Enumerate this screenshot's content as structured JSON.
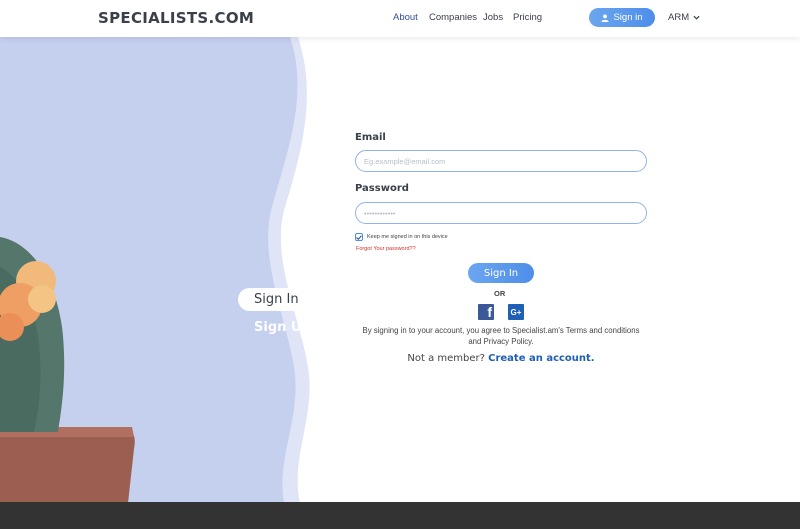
{
  "header": {
    "logo": "SPECIALISTS.COM",
    "nav": [
      "About",
      "Companies",
      "Jobs",
      "Pricing"
    ],
    "active_nav": "About",
    "signin_button": "Sign in",
    "language": "ARM"
  },
  "side_tabs": {
    "signin": "Sign In",
    "signup": "Sign Up"
  },
  "form": {
    "email_label": "Email",
    "email_placeholder": "Eg.example@email.com",
    "password_label": "Password",
    "password_placeholder": "••••••••••••",
    "keep_signed_in": "Keep me signed in on this device",
    "keep_signed_in_checked": true,
    "forgot_password": "Forgot Your password??",
    "submit": "Sign In",
    "or": "OR",
    "social": [
      "facebook-icon",
      "google-plus-icon"
    ],
    "terms": "By signing in to your account, you agree to Specialist.am's Terms and conditions and Privacy Policy.",
    "not_member": "Not a member?",
    "create_account": "Create an account."
  },
  "colors": {
    "accent": "#4e8eea",
    "panel": "#c5cfee",
    "footer": "#333333",
    "error": "#d0322b"
  }
}
